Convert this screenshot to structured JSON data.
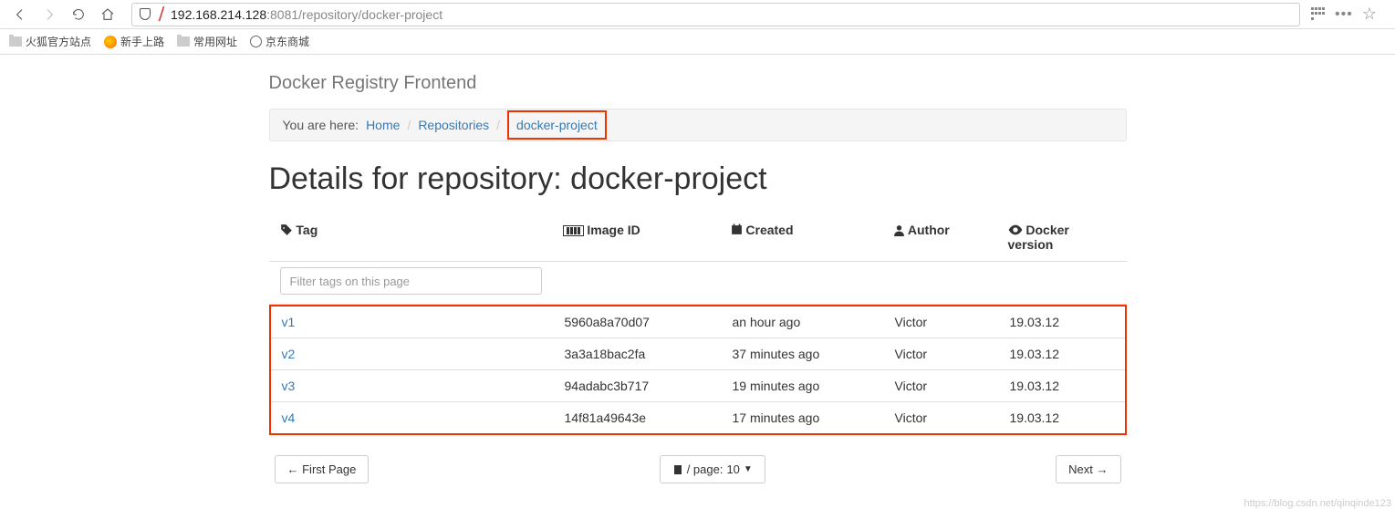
{
  "browser": {
    "url_prefix": "192.168.214.128",
    "url_port_path": ":8081/repository/docker-project"
  },
  "bookmarks": {
    "b1": "火狐官方站点",
    "b2": "新手上路",
    "b3": "常用网址",
    "b4": "京东商城"
  },
  "brand": "Docker Registry Frontend",
  "breadcrumb": {
    "prefix": "You are here:",
    "home": "Home",
    "repos": "Repositories",
    "current": "docker-project"
  },
  "heading": "Details for repository: docker-project",
  "table": {
    "headers": {
      "tag": "Tag",
      "image_id": "Image ID",
      "created": "Created",
      "author": "Author",
      "version": "Docker version"
    },
    "filter_placeholder": "Filter tags on this page",
    "rows": [
      {
        "tag": "v1",
        "image_id": "5960a8a70d07",
        "created": "an hour ago",
        "author": "Victor",
        "version": "19.03.12"
      },
      {
        "tag": "v2",
        "image_id": "3a3a18bac2fa",
        "created": "37 minutes ago",
        "author": "Victor",
        "version": "19.03.12"
      },
      {
        "tag": "v3",
        "image_id": "94adabc3b717",
        "created": "19 minutes ago",
        "author": "Victor",
        "version": "19.03.12"
      },
      {
        "tag": "v4",
        "image_id": "14f81a49643e",
        "created": "17 minutes ago",
        "author": "Victor",
        "version": "19.03.12"
      }
    ]
  },
  "pager": {
    "first": "← First Page",
    "per_page_prefix": "/ page:",
    "per_page_value": "10",
    "next": "Next →"
  },
  "watermark": "https://blog.csdn.net/qinqinde123"
}
